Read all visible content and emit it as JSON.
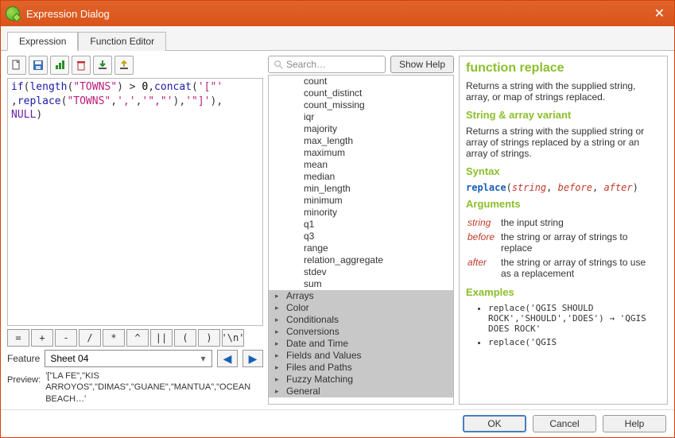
{
  "window": {
    "title": "Expression Dialog"
  },
  "tabs": {
    "expression": "Expression",
    "editor": "Function Editor"
  },
  "toolbar_icons": [
    "new-file",
    "save",
    "history",
    "delete",
    "import",
    "export"
  ],
  "expression": {
    "raw": "if(length(\"TOWNS\") > 0,concat('[\"'\n,replace(\"TOWNS\",',','\",\"'),'\"]'),\nNULL)"
  },
  "operators": [
    "=",
    "+",
    "-",
    "/",
    "*",
    "^",
    "||",
    "(",
    ")",
    "'\\n'"
  ],
  "feature": {
    "label": "Feature",
    "value": "Sheet 04"
  },
  "preview": {
    "label": "Preview:",
    "value": "'[\"LA FE\",\"KIS\nARROYOS\",\"DIMAS\",\"GUANE\",\"MANTUA\",\"OCEAN\nBEACH…'"
  },
  "search": {
    "placeholder": "Search…"
  },
  "show_help": "Show Help",
  "tree": {
    "functions": [
      "count",
      "count_distinct",
      "count_missing",
      "iqr",
      "majority",
      "max_length",
      "maximum",
      "mean",
      "median",
      "min_length",
      "minimum",
      "minority",
      "q1",
      "q3",
      "range",
      "relation_aggregate",
      "stdev",
      "sum"
    ],
    "groups": [
      "Arrays",
      "Color",
      "Conditionals",
      "Conversions",
      "Date and Time",
      "Fields and Values",
      "Files and Paths",
      "Fuzzy Matching",
      "General"
    ]
  },
  "help": {
    "title": "function replace",
    "desc1": "Returns a string with the supplied string, array, or map of strings replaced.",
    "variant_title": "String & array variant",
    "desc2": "Returns a string with the supplied string or array of strings replaced by a string or an array of strings.",
    "syntax_label": "Syntax",
    "fn_name": "replace",
    "args_label": "Arguments",
    "args": [
      {
        "name": "string",
        "desc": "the input string"
      },
      {
        "name": "before",
        "desc": "the string or array of strings to replace"
      },
      {
        "name": "after",
        "desc": "the string or array of strings to use as a replacement"
      }
    ],
    "examples_label": "Examples",
    "ex1a": "replace('QGIS SHOULD ROCK','SHOULD','DOES')",
    "ex1b": "'QGIS DOES ROCK'",
    "ex2a": "replace('QGIS"
  },
  "footer": {
    "ok": "OK",
    "cancel": "Cancel",
    "help": "Help"
  }
}
